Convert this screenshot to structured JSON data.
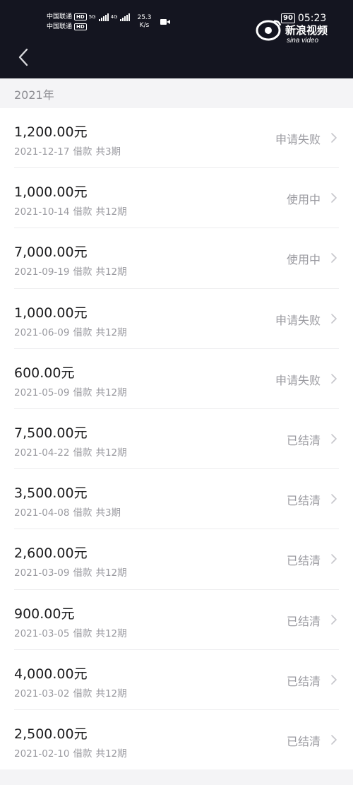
{
  "status_bar": {
    "carrier1": "中国联通",
    "carrier2": "中国联通",
    "hd": "HD",
    "net1": "5G",
    "net2": "4G",
    "speed_value": "25.3",
    "speed_unit": "K/s",
    "battery": "90",
    "time": "05:23"
  },
  "watermark": {
    "brand_cn": "新浪视频",
    "brand_en": "sina video"
  },
  "nav": {
    "back_icon": "chevron-left-icon"
  },
  "section": {
    "year": "2021年"
  },
  "records": [
    {
      "amount": "1,200.00元",
      "date": "2021-12-17",
      "type": "借款",
      "term": "共3期",
      "status": "申请失败"
    },
    {
      "amount": "1,000.00元",
      "date": "2021-10-14",
      "type": "借款",
      "term": "共12期",
      "status": "使用中"
    },
    {
      "amount": "7,000.00元",
      "date": "2021-09-19",
      "type": "借款",
      "term": "共12期",
      "status": "使用中"
    },
    {
      "amount": "1,000.00元",
      "date": "2021-06-09",
      "type": "借款",
      "term": "共12期",
      "status": "申请失败"
    },
    {
      "amount": "600.00元",
      "date": "2021-05-09",
      "type": "借款",
      "term": "共12期",
      "status": "申请失败"
    },
    {
      "amount": "7,500.00元",
      "date": "2021-04-22",
      "type": "借款",
      "term": "共12期",
      "status": "已结清"
    },
    {
      "amount": "3,500.00元",
      "date": "2021-04-08",
      "type": "借款",
      "term": "共3期",
      "status": "已结清"
    },
    {
      "amount": "2,600.00元",
      "date": "2021-03-09",
      "type": "借款",
      "term": "共12期",
      "status": "已结清"
    },
    {
      "amount": "900.00元",
      "date": "2021-03-05",
      "type": "借款",
      "term": "共12期",
      "status": "已结清"
    },
    {
      "amount": "4,000.00元",
      "date": "2021-03-02",
      "type": "借款",
      "term": "共12期",
      "status": "已结清"
    },
    {
      "amount": "2,500.00元",
      "date": "2021-02-10",
      "type": "借款",
      "term": "共12期",
      "status": "已结清"
    }
  ],
  "colors": {
    "header_bg": "#141520",
    "page_bg": "#f4f4f6",
    "text_primary": "#1c1c1e",
    "text_secondary": "#9a9aa0"
  }
}
